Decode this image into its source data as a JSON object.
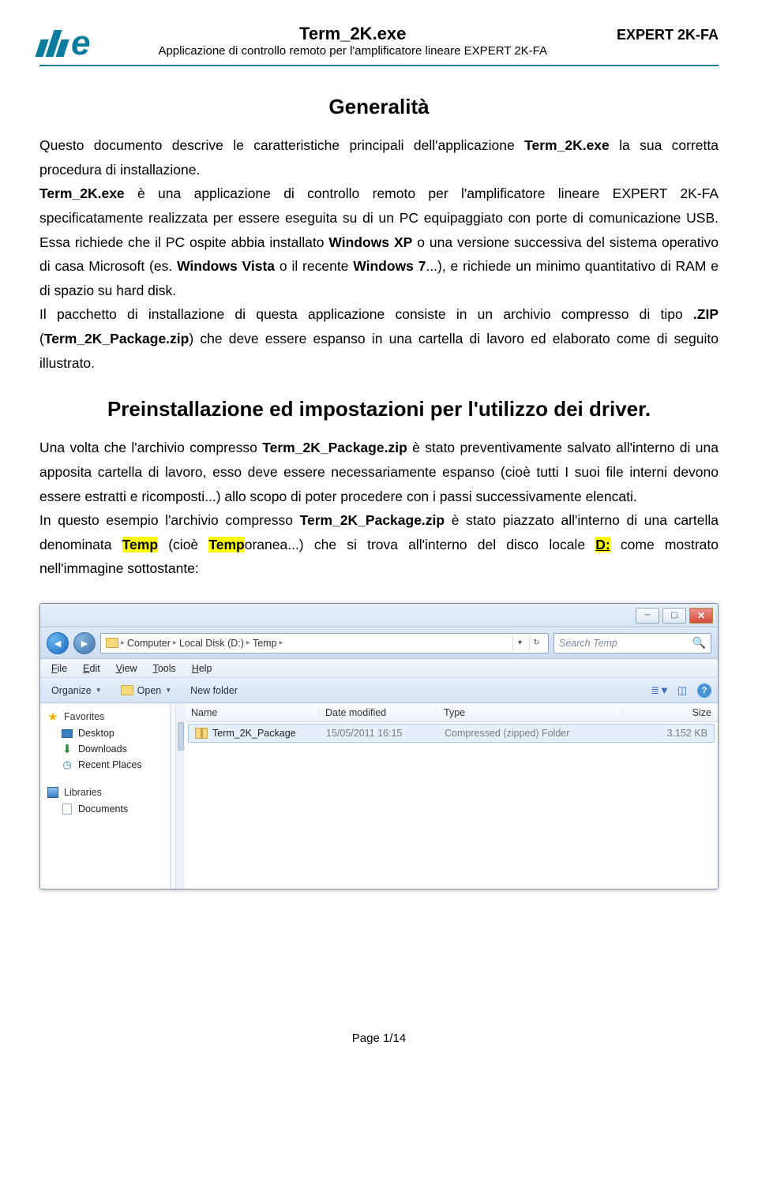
{
  "header": {
    "title": "Term_2K.exe",
    "subtitle": "Applicazione di controllo remoto per l'amplificatore lineare EXPERT 2K-FA",
    "right": "EXPERT 2K-FA"
  },
  "section1_title": "Generalità",
  "para1_a": "Questo documento descrive le caratteristiche principali dell'applicazione ",
  "para1_b": "Term_2K.exe",
  "para1_c": " la sua corretta procedura di installazione.",
  "para2_a": "Term_2K.exe",
  "para2_b": " è una applicazione di controllo remoto per l'amplificatore lineare EXPERT 2K-FA specificatamente realizzata per essere eseguita su di un PC equipaggiato con porte di comunicazione USB. Essa richiede che il PC ospite abbia installato ",
  "para2_c": "Windows XP",
  "para2_d": " o una versione successiva del sistema operativo di casa Microsoft (es. ",
  "para2_e": "Windows Vista",
  "para2_f": " o il recente ",
  "para2_g": "Windows 7",
  "para2_h": "...), e richiede un minimo quantitativo di RAM e di spazio su hard disk.",
  "para3_a": "Il pacchetto di installazione di questa applicazione consiste in un archivio compresso di tipo ",
  "para3_b": ".ZIP",
  "para3_c": " (",
  "para3_d": "Term_2K_Package.zip",
  "para3_e": ") che deve essere espanso in una cartella di lavoro ed elaborato come di seguito illustrato.",
  "section2_title": "Preinstallazione ed impostazioni per l'utilizzo dei driver.",
  "para4_a": "Una volta che l'archivio compresso ",
  "para4_b": "Term_2K_Package.zip",
  "para4_c": " è stato preventivamente salvato all'interno di una apposita cartella di lavoro, esso deve essere necessariamente espanso (cioè tutti I suoi file interni devono essere estratti e ricomposti...) allo scopo di poter procedere con i passi successivamente elencati.",
  "para5_a": "In questo esempio l'archivio compresso ",
  "para5_b": "Term_2K_Package.zip",
  "para5_c": " è stato piazzato all'interno di una cartella denominata ",
  "para5_d": "Temp",
  "para5_e": " (cioè ",
  "para5_f": "Temp",
  "para5_g": "oranea...) che si trova all'interno del disco locale ",
  "para5_h": "D:",
  "para5_i": " come mostrato nell'immagine sottostante:",
  "explorer": {
    "breadcrumb": {
      "seg1": "Computer",
      "seg2": "Local Disk (D:)",
      "seg3": "Temp"
    },
    "search_placeholder": "Search Temp",
    "menubar": {
      "file": "File",
      "edit": "Edit",
      "view": "View",
      "tools": "Tools",
      "help": "Help"
    },
    "cmdbar": {
      "organize": "Organize",
      "open": "Open",
      "newfolder": "New folder"
    },
    "navpane": {
      "favorites": "Favorites",
      "desktop": "Desktop",
      "downloads": "Downloads",
      "recent": "Recent Places",
      "libraries": "Libraries",
      "documents": "Documents"
    },
    "columns": {
      "name": "Name",
      "date": "Date modified",
      "type": "Type",
      "size": "Size"
    },
    "row": {
      "name": "Term_2K_Package",
      "date": "15/05/2011 16:15",
      "type": "Compressed (zipped) Folder",
      "size": "3.152 KB"
    }
  },
  "footer": "Page 1/14"
}
